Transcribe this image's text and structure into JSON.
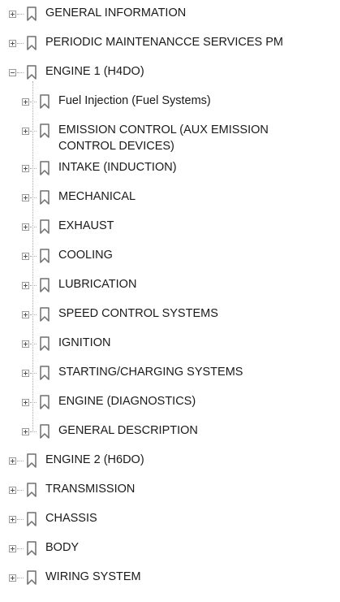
{
  "tree": {
    "items": [
      {
        "label": "GENERAL INFORMATION",
        "expanded": false
      },
      {
        "label": "PERIODIC MAINTENANCCE SERVICES PM",
        "expanded": false
      },
      {
        "label": "ENGINE 1 (H4DO)",
        "expanded": true,
        "children": [
          {
            "label": "Fuel Injection (Fuel Systems)",
            "expanded": false
          },
          {
            "label": "EMISSION CONTROL (AUX EMISSION CONTROL DEVICES)",
            "expanded": false
          },
          {
            "label": "INTAKE (INDUCTION)",
            "expanded": false
          },
          {
            "label": "MECHANICAL",
            "expanded": false
          },
          {
            "label": "EXHAUST",
            "expanded": false
          },
          {
            "label": "COOLING",
            "expanded": false
          },
          {
            "label": "LUBRICATION",
            "expanded": false
          },
          {
            "label": "SPEED CONTROL SYSTEMS",
            "expanded": false
          },
          {
            "label": "IGNITION",
            "expanded": false
          },
          {
            "label": "STARTING/CHARGING SYSTEMS",
            "expanded": false
          },
          {
            "label": "ENGINE (DIAGNOSTICS)",
            "expanded": false
          },
          {
            "label": "GENERAL DESCRIPTION",
            "expanded": false
          }
        ]
      },
      {
        "label": "ENGINE 2 (H6DO)",
        "expanded": false
      },
      {
        "label": "TRANSMISSION",
        "expanded": false
      },
      {
        "label": "CHASSIS",
        "expanded": false
      },
      {
        "label": "BODY",
        "expanded": false
      },
      {
        "label": "WIRING SYSTEM",
        "expanded": false
      }
    ]
  },
  "icons": {
    "toggle_collapsed": "plus-box-icon",
    "toggle_expanded": "minus-box-icon",
    "node": "bookmark-icon"
  },
  "colors": {
    "text": "#1a1a1a",
    "bookmark_stroke": "#6e6e6e",
    "connector": "#a8a8a8"
  }
}
